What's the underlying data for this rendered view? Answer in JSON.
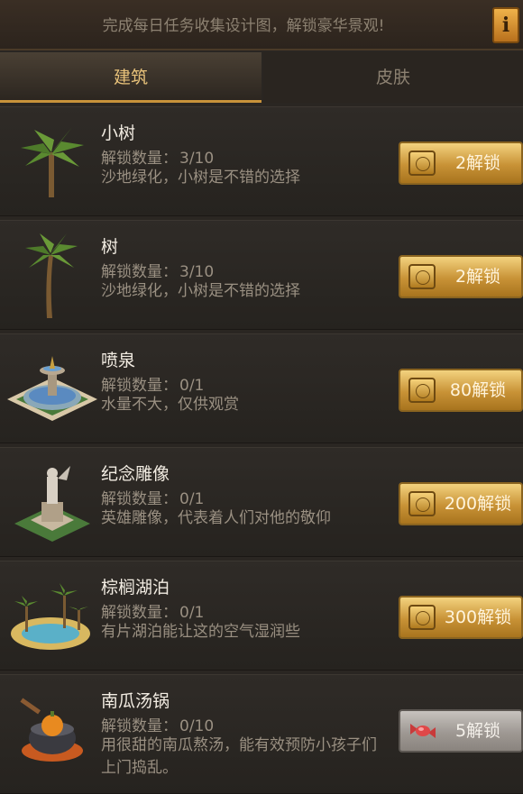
{
  "banner": {
    "text": "完成每日任务收集设计图，解锁豪华景观!",
    "info_icon": "info-icon",
    "info_label": "i"
  },
  "tabs": [
    {
      "label": "建筑"
    },
    {
      "label": "皮肤"
    }
  ],
  "items": [
    {
      "name": "小树",
      "count_label": "解锁数量：",
      "count": "3/10",
      "desc": "沙地绿化，小树是不错的选择",
      "button": "2解锁",
      "icon": "palm-tree-icon"
    },
    {
      "name": "树",
      "count_label": "解锁数量：",
      "count": "3/10",
      "desc": "沙地绿化，小树是不错的选择",
      "button": "2解锁",
      "icon": "tall-palm-icon"
    },
    {
      "name": "喷泉",
      "count_label": "解锁数量：",
      "count": "0/1",
      "desc": "水量不大，仅供观赏",
      "button": "80解锁",
      "icon": "fountain-icon"
    },
    {
      "name": "纪念雕像",
      "count_label": "解锁数量：",
      "count": "0/1",
      "desc": "英雄雕像，代表着人们对他的敬仰",
      "button": "200解锁",
      "icon": "statue-icon"
    },
    {
      "name": "棕榈湖泊",
      "count_label": "解锁数量：",
      "count": "0/1",
      "desc": "有片湖泊能让这的空气湿润些",
      "button": "300解锁",
      "icon": "palm-lake-icon"
    },
    {
      "name": "南瓜汤锅",
      "count_label": "解锁数量：",
      "count": "0/10",
      "desc": "用很甜的南瓜熬汤，能有效预防小孩子们上门捣乱。",
      "button": "5解锁",
      "icon": "pumpkin-pot-icon"
    }
  ],
  "colors": {
    "gold": "#c89236",
    "accent_text": "#e8c27a",
    "background": "#2a2622"
  }
}
